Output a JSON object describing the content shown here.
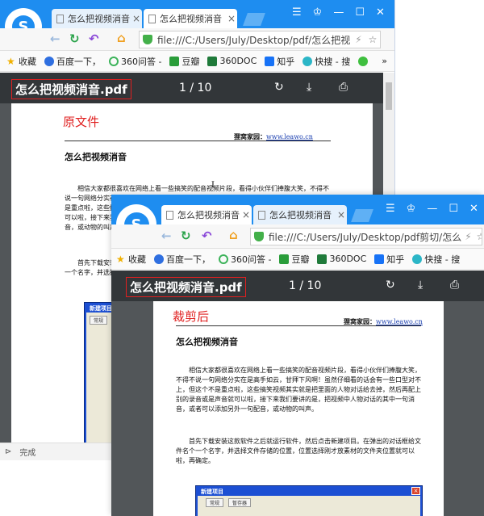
{
  "original": {
    "tabs": [
      {
        "title": "怎么把视频消音"
      },
      {
        "title": "怎么把视频消音"
      }
    ],
    "url": "file:///C:/Users/July/Desktop/pdf/怎么把视",
    "bookmarks": [
      "收藏",
      "百度一下，",
      "360问答 -",
      "豆瓣",
      "360DOC",
      "知乎",
      "快搜 - 搜"
    ],
    "more": "»",
    "pdf": {
      "filename": "怎么把视频消音.pdf",
      "page_current": "1",
      "page_sep": "/",
      "page_total": "10"
    },
    "note": "原文件",
    "doc": {
      "site_label": "狸窝家园：",
      "site_url": "www.leawo.cn",
      "title": "怎么把视频消音",
      "p1": "相信大家都很喜欢在网络上看一些搞笑的配音视频片段，看得小伙伴们捧腹大笑，不得不说一句网络分实在是高手如云，甘拜下风啊！虽然仔细看的话会有一些口型对不上，但这个不是重点啦，这些搞笑视频其实就是把里面的人物对话给去掉，然后再配上别的录音或是声音就可以啦，接下来我们要讲的是，把视频中人物对话的其中一句消音，或者可以添加另外一句配音，或动物的叫声。",
      "p2": "首先下载安装这款软件之后就运行软件，然后点击新建项目。在弹出的对话框给文件名个一个名字，并选择文件存储的位置，位置选择刚才放素材的文件夹位置就可以啦，再确定。",
      "dialog_title": "新建项目",
      "dialog_tabs": [
        "常规"
      ]
    },
    "status": "完成"
  },
  "cropped": {
    "tabs": [
      {
        "title": "怎么把视频消音"
      },
      {
        "title": "怎么把视频消音"
      }
    ],
    "url": "file:///C:/Users/July/Desktop/pdf剪切/怎么",
    "bookmarks": [
      "收藏",
      "百度一下，",
      "360问答 -",
      "豆瓣",
      "360DOC",
      "知乎",
      "快搜 - 搜"
    ],
    "pdf": {
      "filename": "怎么把视频消音.pdf",
      "page_current": "1",
      "page_sep": "/",
      "page_total": "10"
    },
    "note": "裁剪后",
    "doc": {
      "site_label": "狸窝家园：",
      "site_url": "www.leawo.cn",
      "title": "怎么把视频消音",
      "p1": "相信大家都很喜欢在网络上看一些搞笑的配音视频片段，看得小伙伴们捧腹大笑，不得不说一句网络分实在是高手如云，甘拜下风啊！虽然仔细看的话会有一些口型对不上，但这个不是重点啦，这些搞笑视频其实就是把里面的人物对话给去掉，然后再配上别的录音或是声音就可以啦，接下来我们要讲的是，把视频中人物对话的其中一句消音，或者可以添加另外一句配音，或动物的叫声。",
      "p2": "首先下载安装这款软件之后就运行软件，然后点击新建项目。在弹出的对话框给文件名个一个名字，并选择文件存储的位置，位置选择刚才放素材的文件夹位置就可以啦，再确定。",
      "dialog_title": "新建项目",
      "dialog_tabs": [
        "常规",
        "暂存器"
      ]
    }
  },
  "colors": {
    "tabbar": "#1e8df0",
    "pdf_toolbar": "#323639",
    "viewer_bg": "#525659",
    "annotation_red": "#e02020"
  }
}
